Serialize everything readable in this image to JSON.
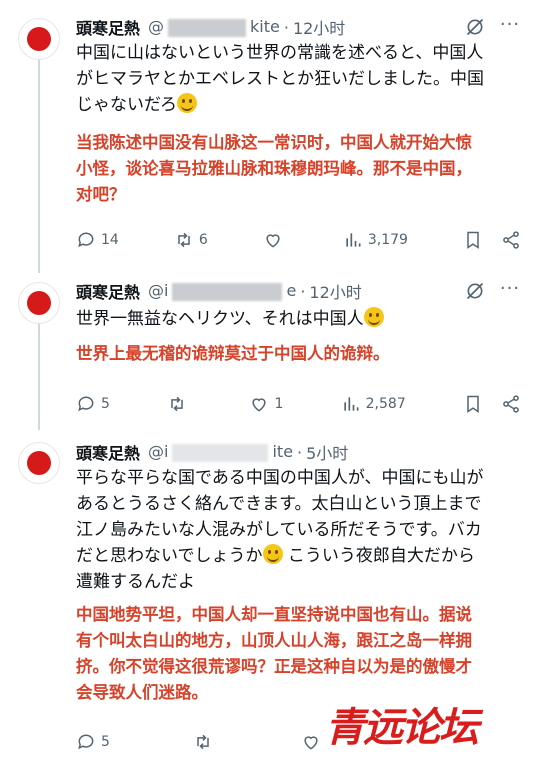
{
  "tweets": [
    {
      "name": "頭寒足熱",
      "handle_start": "@",
      "handle_end": "kite",
      "time": "12小时",
      "text_jp_lines": [
        "中国に山はないという世界の常識を述べると、中国人",
        "がヒマラヤとかエベレストとか狂いだしました。中国",
        "じゃないだろ"
      ],
      "text_zh_lines": [
        "当我陈述中国没有山脉这一常识时，中国人就开始大惊",
        "小怪，谈论喜马拉雅山脉和珠穆朗玛峰。那不是中国，",
        "对吧？"
      ],
      "replies": "14",
      "reposts": "6",
      "likes": "",
      "views": "3,179"
    },
    {
      "name": "頭寒足熱",
      "handle_start": "@i",
      "handle_end": "e",
      "time": "12小时",
      "text_jp_lines": [
        "世界一無益なヘリクツ、それは中国人"
      ],
      "text_zh_lines": [
        "世界上最无稽的诡辩莫过于中国人的诡辩。"
      ],
      "replies": "5",
      "reposts": "",
      "likes": "1",
      "views": "2,587"
    },
    {
      "name": "頭寒足熱",
      "handle_start": "@i",
      "handle_end": "ite",
      "time": "5小时",
      "text_jp_lines": [
        "平らな平らな国である中国の中国人が、中国にも山が",
        "あるとうるさく絡んできます。太白山という頂上まで",
        "江ノ島みたいな人混みがしている所だそうです。バカ",
        "だと思わないでしょうか",
        "遭難するんだよ"
      ],
      "text_jp_line4_tail": " こういう夜郎自大だから",
      "text_zh_lines": [
        "中国地势平坦，中国人却一直坚持说中国也有山。据说",
        "有个叫太白山的地方，山顶人山人海，跟江之岛一样拥",
        "挤。你不觉得这很荒谬吗？正是这种自以为是的傲慢才",
        "会导致人们迷路。"
      ],
      "replies": "5",
      "reposts": "",
      "likes": "",
      "views": ""
    }
  ],
  "separator": "·",
  "watermark": "青远论坛",
  "colors": {
    "translation": "#d7422a",
    "avatar": "#d61a1a",
    "muted": "#536471"
  }
}
